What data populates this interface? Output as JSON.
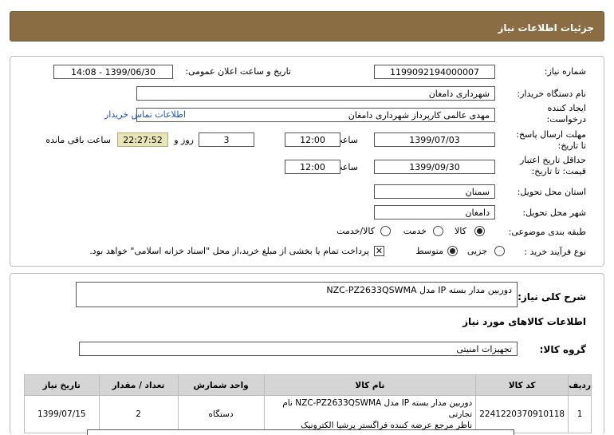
{
  "header": {
    "title": "جزئیات اطلاعات نیاز"
  },
  "form": {
    "need_number_label": "شماره نیاز:",
    "need_number": "1199092194000007",
    "announce_label": "تاریخ و ساعت اعلان عمومی:",
    "announce_value": "1399/06/30 - 14:08",
    "buyer_org_label": "نام دستگاه خریدار:",
    "buyer_org": "شهرداری دامغان",
    "requester_label_1": "ایجاد کننده",
    "requester_label_2": "درخواست:",
    "requester": "مهدی عالمی کارپرداز شهرداری دامغان",
    "contact_link": "اطلاعات تماس خریدار",
    "reply_label_1": "مهلت ارسال پاسخ:",
    "reply_label_2": "تا تاریخ:",
    "reply_date": "1399/07/03",
    "time_label": "ساعت",
    "reply_time": "12:00",
    "days_value": "3",
    "days_label": "روز و",
    "remaining_time": "22:27:52",
    "remaining_label": "ساعت باقی مانده",
    "validity_label_1": "حداقل تاریخ اعتبار",
    "validity_label_2": "قیمت: تا تاریخ:",
    "validity_date": "1399/09/30",
    "validity_time_label": "ساعت",
    "validity_time": "12:00",
    "province_label": "استان محل تحویل:",
    "province": "سمنان",
    "city_label": "شهر محل تحویل:",
    "city": "دامغان",
    "category_label": "طبقه بندی موضوعی:",
    "category_options": [
      "کالا",
      "خدمت",
      "کالا/خدمت"
    ],
    "process_label": "نوع فرآیند خرید :",
    "process_options": [
      "جزیی",
      "متوسط"
    ],
    "payment_note": "پرداخت تمام یا بخشی از مبلغ خرید،از محل \"اسناد خزانه اسلامی\" خواهد بود."
  },
  "details": {
    "summary_label": "شرح کلی نیاز:",
    "summary": "دوربین مدار بسته IP مدل NZC-PZ2633QSWMA",
    "goods_info_title": "اطلاعات کالاهای مورد نیاز",
    "group_label": "گروه کالا:",
    "group": "تجهیزات امنیتی",
    "table": {
      "headers": [
        "ردیف",
        "کد کالا",
        "نام کالا",
        "واحد شمارش",
        "تعداد / مقدار",
        "تاریخ نیاز"
      ],
      "rows": [
        {
          "row": "1",
          "code": "2241220370910118",
          "name_1": "دوربین مدار بسته IP مدل NZC-PZ2633QSWMA نام تجارتی",
          "name_2": "ناظر مرجع عرضه کننده فراگستر پرشیا الکترونیک",
          "unit": "دستگاه",
          "qty": "2",
          "date": "1399/07/15"
        }
      ]
    }
  }
}
